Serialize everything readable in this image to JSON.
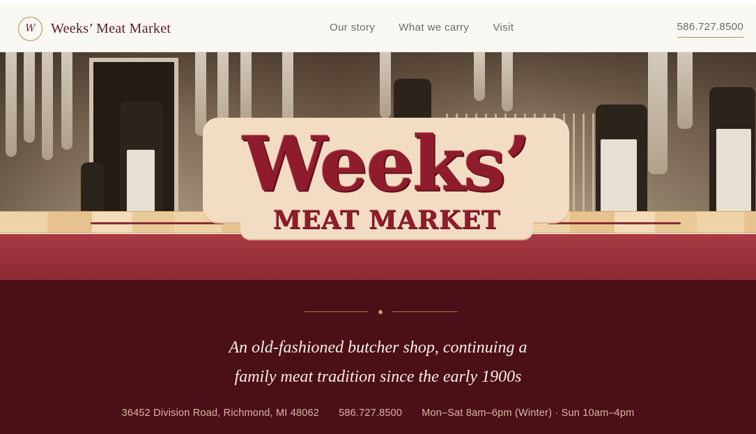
{
  "header": {
    "logo_mark": "W",
    "brand_name": "Weeks’ Meat Market",
    "nav": [
      {
        "label": "Our story"
      },
      {
        "label": "What we carry"
      },
      {
        "label": "Visit"
      }
    ],
    "phone": "586.727.8500"
  },
  "hero": {
    "logo_title": "Weeks’",
    "logo_subtitle": "MEAT MARKET"
  },
  "intro": {
    "tagline_line1": "An old-fashioned butcher shop, continuing a",
    "tagline_line2": "family meat tradition since the early 1900s",
    "address": "36452 Division Road, Richmond, MI 48062",
    "phone": "586.727.8500",
    "hours": "Mon–Sat 8am–6pm (Winter) · Sun 10am–4pm"
  },
  "colors": {
    "brand_red": "#8f1c2c",
    "intro_background": "#4b0f17",
    "accent_gold": "#b08a4a"
  }
}
